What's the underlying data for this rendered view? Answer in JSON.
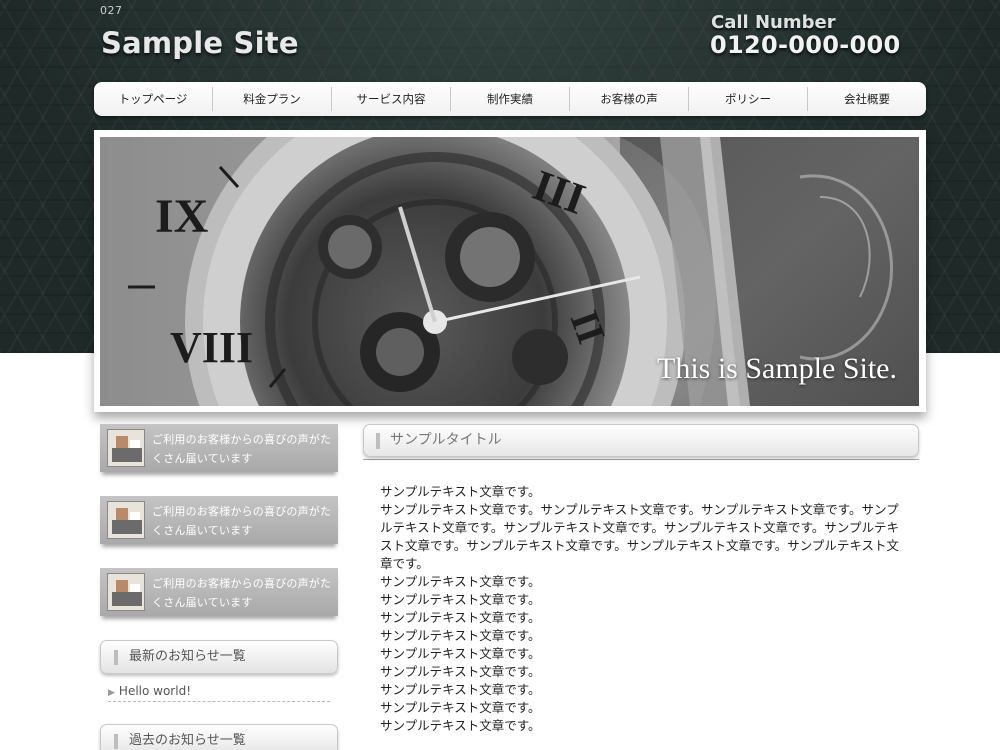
{
  "header": {
    "site_code": "027",
    "logo": "Sample Site",
    "call_label": "Call Number",
    "call_number": "0120-000-000"
  },
  "nav": {
    "items": [
      {
        "label": "トップページ"
      },
      {
        "label": "料金プラン"
      },
      {
        "label": "サービス内容"
      },
      {
        "label": "制作実績"
      },
      {
        "label": "お客様の声"
      },
      {
        "label": "ポリシー"
      },
      {
        "label": "会社概要"
      }
    ]
  },
  "hero": {
    "caption": "This is Sample Site."
  },
  "sidebar": {
    "banners": [
      {
        "text": "ご利用のお客様からの喜びの声がたくさん届いています"
      },
      {
        "text": "ご利用のお客様からの喜びの声がたくさん届いています"
      },
      {
        "text": "ご利用のお客様からの喜びの声がたくさん届いています"
      }
    ],
    "news_heading": "最新のお知らせ一覧",
    "news_items": [
      {
        "label": "Hello world!"
      }
    ],
    "archive_heading": "過去のお知らせ一覧"
  },
  "main": {
    "title": "サンプルタイトル",
    "paragraph": "サンプルテキスト文章です。サンプルテキスト文章です。サンプルテキスト文章です。サンプルテキスト文章です。サンプルテキスト文章です。サンプルテキスト文章です。サンプルテキスト文章です。サンプルテキスト文章です。サンプルテキスト文章です。サンプルテキスト文章です。",
    "lines": [
      "サンプルテキスト文章です。",
      "サンプルテキスト文章です。",
      "サンプルテキスト文章です。",
      "サンプルテキスト文章です。",
      "サンプルテキスト文章です。",
      "サンプルテキスト文章です。",
      "サンプルテキスト文章です。",
      "サンプルテキスト文章です。",
      "サンプルテキスト文章です。"
    ],
    "first_line": "サンプルテキスト文章です。"
  }
}
